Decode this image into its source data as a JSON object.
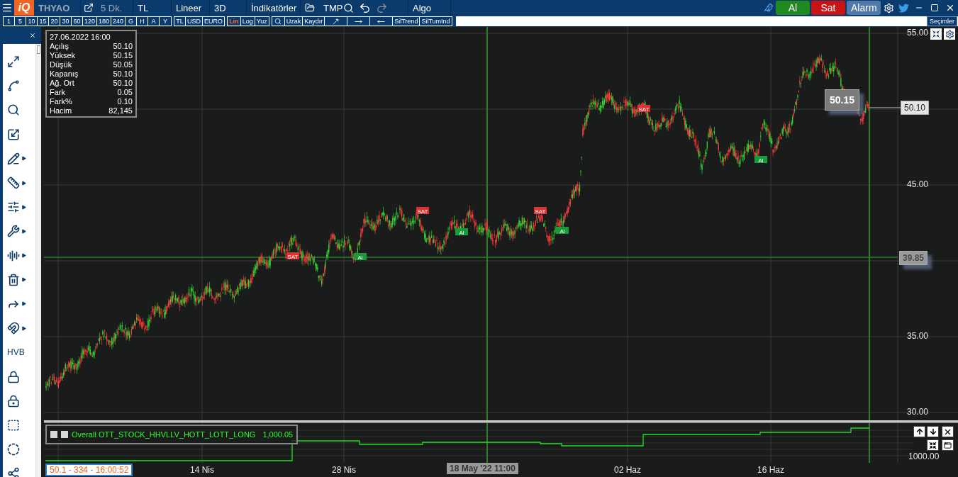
{
  "top_bar": {
    "logo": "iQ",
    "symbol": "THYAO",
    "period": "5 Dk.",
    "currency": "TL",
    "scale": "Lineer",
    "mode": "3D",
    "indicators": "İndikatörler",
    "template": "TMP",
    "algo": "Algo",
    "buy": "Al",
    "sell": "Sat",
    "alarm": "Alarm",
    "redo_disabled": true
  },
  "interval_buttons": [
    "1",
    "5",
    "10",
    "15",
    "20",
    "30",
    "60",
    "120",
    "180",
    "240",
    "G",
    "H",
    "A",
    "Y"
  ],
  "currency_buttons": [
    "TL",
    "USD",
    "EURO"
  ],
  "scale_buttons": [
    {
      "label": "Lin",
      "selected": true
    },
    {
      "label": "Log",
      "selected": false
    },
    {
      "label": "Yuz",
      "selected": false
    }
  ],
  "tool_buttons": [
    "Uzak",
    "Kaydır"
  ],
  "clear_buttons": [
    "SilTrend",
    "SilTumInd"
  ],
  "selections_tooltip": "Seçimler",
  "sidebar": {
    "tools": [
      {
        "kind": "icon",
        "submenu": false
      },
      {
        "kind": "icon",
        "submenu": false
      },
      {
        "kind": "icon",
        "submenu": false
      },
      {
        "kind": "icon",
        "submenu": false
      },
      {
        "kind": "icon",
        "submenu": true
      },
      {
        "kind": "icon",
        "submenu": true
      },
      {
        "kind": "icon",
        "submenu": true
      },
      {
        "kind": "icon",
        "submenu": true
      },
      {
        "kind": "icon",
        "submenu": true
      },
      {
        "kind": "icon",
        "submenu": true
      },
      {
        "kind": "icon",
        "submenu": true
      },
      {
        "kind": "icon",
        "submenu": true
      },
      {
        "kind": "text",
        "label": "HVB",
        "submenu": false
      },
      {
        "kind": "icon",
        "submenu": false
      },
      {
        "kind": "icon",
        "submenu": false
      },
      {
        "kind": "icon",
        "submenu": false
      },
      {
        "kind": "icon",
        "submenu": false
      },
      {
        "kind": "icon",
        "submenu": false
      }
    ]
  },
  "info_box": {
    "datetime": "27.06.2022 16:00",
    "rows": [
      {
        "label": "Açılış",
        "value": "50.10"
      },
      {
        "label": "Yüksek",
        "value": "50.15"
      },
      {
        "label": "Düşük",
        "value": "50.05"
      },
      {
        "label": "Kapanış",
        "value": "50.10"
      },
      {
        "label": "Ağ. Ort",
        "value": "50.10"
      },
      {
        "label": "Fark",
        "value": "0.05"
      },
      {
        "label": "Fark%",
        "value": "0.10"
      },
      {
        "label": "Hacim",
        "value": "82,145"
      }
    ]
  },
  "signals": [
    {
      "kind": "sell",
      "label": "SAT"
    },
    {
      "kind": "buy",
      "label": "Al"
    },
    {
      "kind": "sell",
      "label": "SAT"
    },
    {
      "kind": "buy",
      "label": "Al"
    },
    {
      "kind": "sell",
      "label": "SAT"
    },
    {
      "kind": "buy",
      "label": "Al"
    },
    {
      "kind": "sell",
      "label": "SAT"
    },
    {
      "kind": "buy",
      "label": "Al"
    }
  ],
  "price_axis": {
    "labels": [
      "55.00",
      "45.00",
      "35.00",
      "30.00"
    ],
    "last_price": "50.10",
    "crosshair_price": "39.85",
    "hover_price": "50.15"
  },
  "indicator_panel": {
    "checkboxes": [
      {
        "checked": false
      },
      {
        "checked": false
      }
    ],
    "name": "Overall OTT_STOCK_HHVLLV_HOTT_LOTT_LONG",
    "value": "1,000.05",
    "axis_label": "1000.00"
  },
  "time_axis": {
    "status": "50.1 - 334 - 16:00:52",
    "labels": [
      "14 Nis",
      "28 Nis",
      "02 Haz",
      "16 Haz"
    ],
    "crosshair_time": "18 May '22 11:00"
  }
}
